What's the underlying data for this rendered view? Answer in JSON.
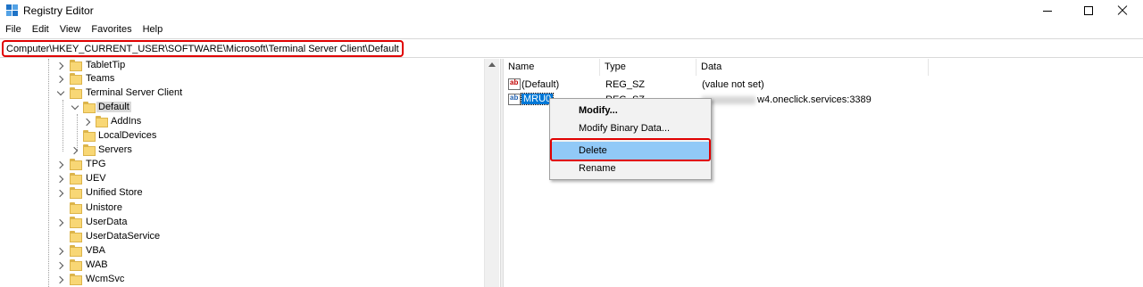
{
  "window": {
    "title": "Registry Editor",
    "icon": "registry-icon",
    "controls": [
      "minimize-icon",
      "maximize-icon",
      "close-icon"
    ]
  },
  "menu": [
    "File",
    "Edit",
    "View",
    "Favorites",
    "Help"
  ],
  "address": "Computer\\HKEY_CURRENT_USER\\SOFTWARE\\Microsoft\\Terminal Server Client\\Default",
  "tree": {
    "items": [
      {
        "label": "TabletTip",
        "expander": "collapsed"
      },
      {
        "label": "Teams",
        "expander": "collapsed"
      },
      {
        "label": "Terminal Server Client",
        "expander": "expanded"
      },
      {
        "label": "Default",
        "expander": "expanded",
        "selected": true
      },
      {
        "label": "AddIns",
        "expander": "collapsed"
      },
      {
        "label": "LocalDevices",
        "expander": "none"
      },
      {
        "label": "Servers",
        "expander": "collapsed"
      },
      {
        "label": "TPG",
        "expander": "collapsed"
      },
      {
        "label": "UEV",
        "expander": "collapsed"
      },
      {
        "label": "Unified Store",
        "expander": "collapsed"
      },
      {
        "label": "Unistore",
        "expander": "none"
      },
      {
        "label": "UserData",
        "expander": "collapsed"
      },
      {
        "label": "UserDataService",
        "expander": "none"
      },
      {
        "label": "VBA",
        "expander": "collapsed"
      },
      {
        "label": "WAB",
        "expander": "collapsed"
      },
      {
        "label": "WcmSvc",
        "expander": "collapsed"
      }
    ]
  },
  "values": {
    "headers": [
      "Name",
      "Type",
      "Data"
    ],
    "rows": [
      {
        "name": "(Default)",
        "type": "REG_SZ",
        "data": "(value not set)"
      },
      {
        "name": "MRU0",
        "type": "REG_SZ",
        "data": "w4.oneclick.services:3389",
        "selected": true
      }
    ]
  },
  "context_menu": {
    "items": [
      {
        "label": "Modify...",
        "bold": true
      },
      {
        "label": "Modify Binary Data..."
      },
      {
        "label": "Delete",
        "highlighted": true
      },
      {
        "label": "Rename"
      }
    ]
  },
  "colors": {
    "highlight_red": "#e00000",
    "selection_blue": "#0078d7",
    "menu_hover": "#91c9f7"
  }
}
